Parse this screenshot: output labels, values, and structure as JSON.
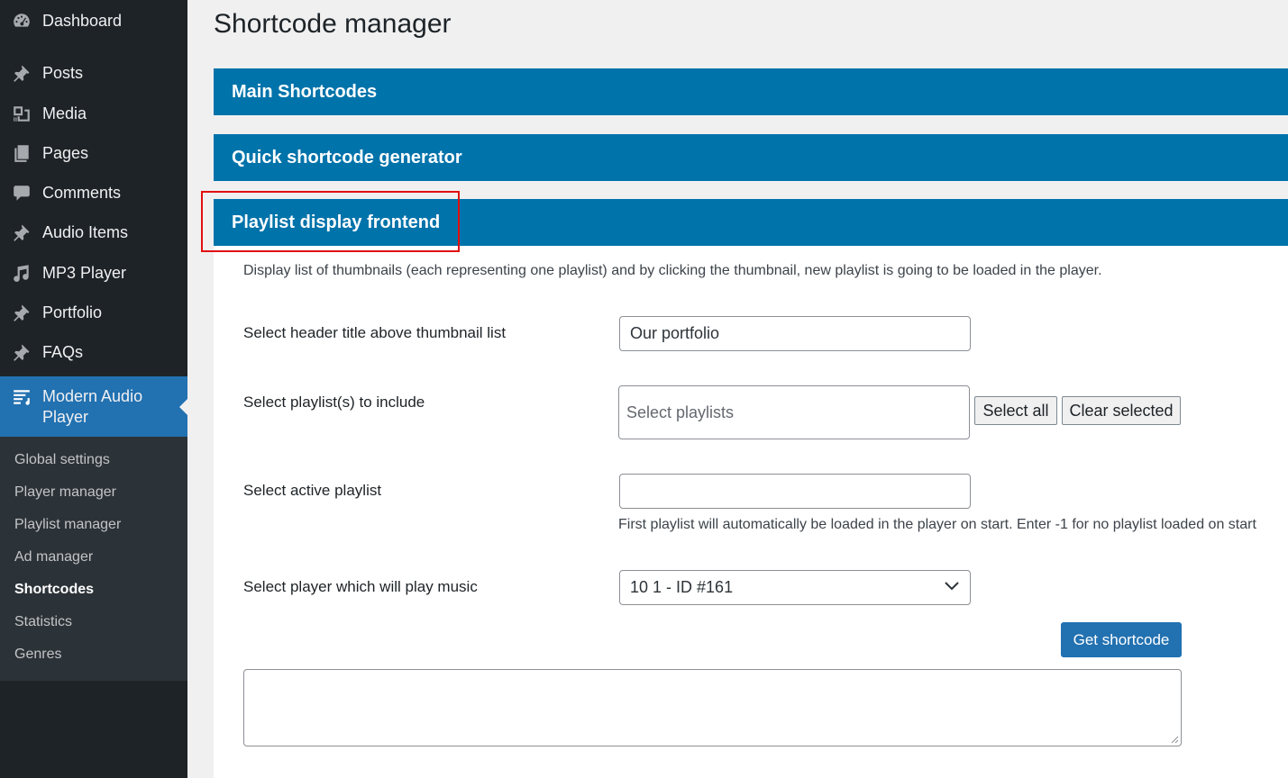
{
  "sidebar": {
    "items": [
      {
        "label": "Dashboard",
        "icon": "dashboard-icon"
      },
      {
        "label": "Posts",
        "icon": "pushpin-icon"
      },
      {
        "label": "Media",
        "icon": "media-icon"
      },
      {
        "label": "Pages",
        "icon": "pages-icon"
      },
      {
        "label": "Comments",
        "icon": "comment-icon"
      },
      {
        "label": "Audio Items",
        "icon": "pushpin-icon"
      },
      {
        "label": "MP3 Player",
        "icon": "music-note-icon"
      },
      {
        "label": "Portfolio",
        "icon": "pushpin-icon"
      },
      {
        "label": "FAQs",
        "icon": "pushpin-icon"
      },
      {
        "label": "Modern Audio Player",
        "icon": "playlist-icon"
      }
    ],
    "submenu": [
      {
        "label": "Global settings"
      },
      {
        "label": "Player manager"
      },
      {
        "label": "Playlist manager"
      },
      {
        "label": "Ad manager"
      },
      {
        "label": "Shortcodes"
      },
      {
        "label": "Statistics"
      },
      {
        "label": "Genres"
      }
    ]
  },
  "page": {
    "title": "Shortcode manager"
  },
  "panels": [
    {
      "label": "Main Shortcodes"
    },
    {
      "label": "Quick shortcode generator"
    },
    {
      "label": "Playlist display frontend"
    }
  ],
  "playlist_display": {
    "description": "Display list of thumbnails (each representing one playlist) and by clicking the thumbnail, new playlist is going to be loaded in the player.",
    "header_title_label": "Select header title above thumbnail list",
    "header_title_value": "Our portfolio",
    "playlists_label": "Select playlist(s) to include",
    "playlists_placeholder": "Select playlists",
    "select_all": "Select all",
    "clear_selected": "Clear selected",
    "active_playlist_label": "Select active playlist",
    "active_playlist_value": "",
    "active_playlist_help": "First playlist will automatically be loaded in the player on start. Enter -1 for no playlist loaded on start",
    "player_label": "Select player which will play music",
    "player_value": "10 1 - ID #161",
    "get_shortcode": "Get shortcode",
    "output_value": ""
  },
  "colors": {
    "sidebar_bg": "#1d2327",
    "submenu_bg": "#2c3338",
    "accent": "#2271b1",
    "panel_header": "#0073aa",
    "highlight": "#e0100f"
  }
}
